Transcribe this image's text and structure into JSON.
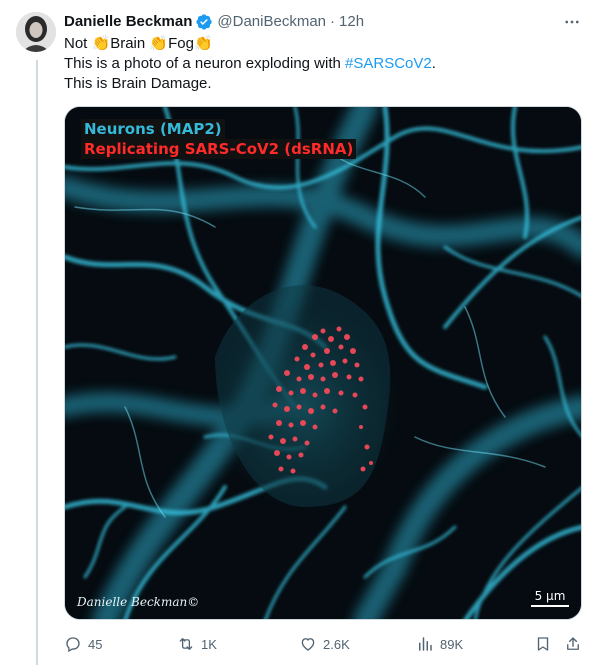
{
  "author": {
    "name": "Danielle Beckman",
    "handle": "@DaniBeckman",
    "time": "12h",
    "verified": true
  },
  "tweet": {
    "line1": {
      "word1": "Not ",
      "word2": "Brain ",
      "word3": "Fog"
    },
    "line2_prefix": "This is a photo of a neuron exploding with ",
    "line2_hashtag": "#SARSCoV2",
    "line2_suffix": ".",
    "line3": "This is Brain Damage.",
    "emoji": "clapping-hands"
  },
  "media": {
    "legend_neurons": "Neurons (MAP2)",
    "legend_virus": "Replicating SARS-CoV2 (dsRNA)",
    "signature": "Danielle Beckman©",
    "scale_label": "5 μm",
    "colors": {
      "neurons": "#36b9d8",
      "virus": "#ff4a5a",
      "background": "#050b10"
    }
  },
  "actions": {
    "replies": "45",
    "retweets": "1K",
    "likes": "2.6K",
    "views": "89K"
  },
  "colors": {
    "link": "#1d9bf0",
    "secondary": "#536471",
    "verified": "#1d9bf0"
  }
}
